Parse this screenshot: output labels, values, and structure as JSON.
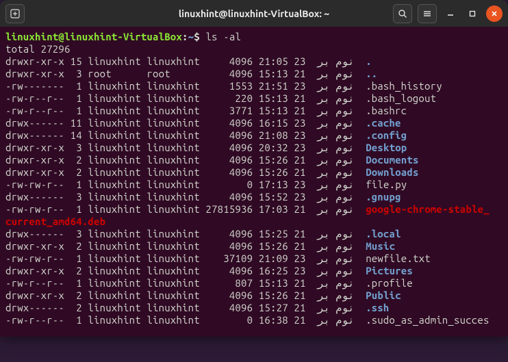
{
  "titlebar": {
    "title": "linuxhint@linuxhint-VirtualBox: ~"
  },
  "prompt": {
    "userhost": "linuxhint@linuxhint-VirtualBox",
    "sep": ":",
    "path": "~",
    "sigil": "$",
    "command": "ls -al"
  },
  "total_line": "total 27296",
  "month": "نوم بر",
  "wrap_line": "current_amd64.deb",
  "rows": [
    {
      "perm": "drwxr-xr-x",
      "links": "15",
      "owner": "linuxhint",
      "group": "linuxhint",
      "size": "4096",
      "time": "21:05",
      "day": "23",
      "name": ".",
      "cls": "blue"
    },
    {
      "perm": "drwxr-xr-x",
      "links": "3",
      "owner": "root",
      "group": "root",
      "size": "4096",
      "time": "15:13",
      "day": "21",
      "name": "..",
      "cls": "blue"
    },
    {
      "perm": "-rw-------",
      "links": "1",
      "owner": "linuxhint",
      "group": "linuxhint",
      "size": "1553",
      "time": "21:51",
      "day": "23",
      "name": ".bash_history",
      "cls": ""
    },
    {
      "perm": "-rw-r--r--",
      "links": "1",
      "owner": "linuxhint",
      "group": "linuxhint",
      "size": "220",
      "time": "15:13",
      "day": "21",
      "name": ".bash_logout",
      "cls": ""
    },
    {
      "perm": "-rw-r--r--",
      "links": "1",
      "owner": "linuxhint",
      "group": "linuxhint",
      "size": "3771",
      "time": "15:13",
      "day": "21",
      "name": ".bashrc",
      "cls": ""
    },
    {
      "perm": "drwx------",
      "links": "11",
      "owner": "linuxhint",
      "group": "linuxhint",
      "size": "4096",
      "time": "16:15",
      "day": "23",
      "name": ".cache",
      "cls": "blue"
    },
    {
      "perm": "drwx------",
      "links": "14",
      "owner": "linuxhint",
      "group": "linuxhint",
      "size": "4096",
      "time": "21:08",
      "day": "23",
      "name": ".config",
      "cls": "blue"
    },
    {
      "perm": "drwxr-xr-x",
      "links": "3",
      "owner": "linuxhint",
      "group": "linuxhint",
      "size": "4096",
      "time": "20:32",
      "day": "23",
      "name": "Desktop",
      "cls": "blue"
    },
    {
      "perm": "drwxr-xr-x",
      "links": "2",
      "owner": "linuxhint",
      "group": "linuxhint",
      "size": "4096",
      "time": "15:26",
      "day": "21",
      "name": "Documents",
      "cls": "blue"
    },
    {
      "perm": "drwxr-xr-x",
      "links": "2",
      "owner": "linuxhint",
      "group": "linuxhint",
      "size": "4096",
      "time": "15:26",
      "day": "21",
      "name": "Downloads",
      "cls": "blue"
    },
    {
      "perm": "-rw-rw-r--",
      "links": "1",
      "owner": "linuxhint",
      "group": "linuxhint",
      "size": "0",
      "time": "17:13",
      "day": "23",
      "name": "file.py",
      "cls": ""
    },
    {
      "perm": "drwx------",
      "links": "3",
      "owner": "linuxhint",
      "group": "linuxhint",
      "size": "4096",
      "time": "15:52",
      "day": "23",
      "name": ".gnupg",
      "cls": "blue"
    },
    {
      "perm": "-rw-rw-r--",
      "links": "1",
      "owner": "linuxhint",
      "group": "linuxhint",
      "size": "27815936",
      "time": "17:03",
      "day": "21",
      "name": "google-chrome-stable_",
      "cls": "red"
    },
    {
      "perm": "drwx------",
      "links": "3",
      "owner": "linuxhint",
      "group": "linuxhint",
      "size": "4096",
      "time": "15:25",
      "day": "21",
      "name": ".local",
      "cls": "blue"
    },
    {
      "perm": "drwxr-xr-x",
      "links": "2",
      "owner": "linuxhint",
      "group": "linuxhint",
      "size": "4096",
      "time": "15:26",
      "day": "21",
      "name": "Music",
      "cls": "blue"
    },
    {
      "perm": "-rw-rw-r--",
      "links": "1",
      "owner": "linuxhint",
      "group": "linuxhint",
      "size": "37109",
      "time": "21:09",
      "day": "23",
      "name": "newfile.txt",
      "cls": ""
    },
    {
      "perm": "drwxr-xr-x",
      "links": "2",
      "owner": "linuxhint",
      "group": "linuxhint",
      "size": "4096",
      "time": "16:25",
      "day": "23",
      "name": "Pictures",
      "cls": "blue"
    },
    {
      "perm": "-rw-r--r--",
      "links": "1",
      "owner": "linuxhint",
      "group": "linuxhint",
      "size": "807",
      "time": "15:13",
      "day": "21",
      "name": ".profile",
      "cls": ""
    },
    {
      "perm": "drwxr-xr-x",
      "links": "2",
      "owner": "linuxhint",
      "group": "linuxhint",
      "size": "4096",
      "time": "15:26",
      "day": "21",
      "name": "Public",
      "cls": "blue"
    },
    {
      "perm": "drwx------",
      "links": "2",
      "owner": "linuxhint",
      "group": "linuxhint",
      "size": "4096",
      "time": "15:27",
      "day": "21",
      "name": ".ssh",
      "cls": "blue"
    },
    {
      "perm": "-rw-r--r--",
      "links": "1",
      "owner": "linuxhint",
      "group": "linuxhint",
      "size": "0",
      "time": "16:38",
      "day": "21",
      "name": ".sudo_as_admin_succes",
      "cls": ""
    }
  ]
}
